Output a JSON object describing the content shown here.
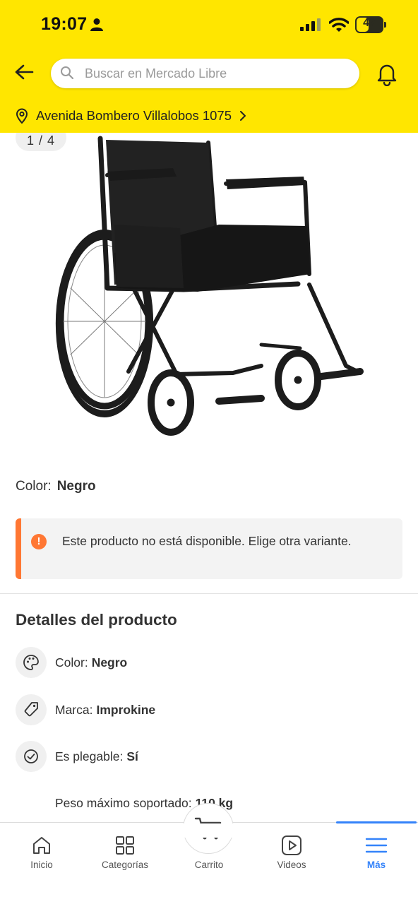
{
  "status_bar": {
    "time": "19:07",
    "battery_level": "47",
    "battery_fraction": 0.47,
    "icons": [
      "person-icon",
      "signal-icon",
      "wifi-icon",
      "battery-icon"
    ]
  },
  "header": {
    "search": {
      "placeholder": "Buscar en Mercado Libre",
      "value": ""
    },
    "address": "Avenida Bombero Villalobos 1075",
    "icons": [
      "back-arrow-icon",
      "search-icon",
      "bell-icon",
      "location-pin-icon",
      "chevron-right-icon"
    ]
  },
  "gallery": {
    "counter": "1 / 4"
  },
  "variant": {
    "label": "Color:",
    "value": "Negro"
  },
  "alert": {
    "message": "Este producto no está disponible. Elige otra variante."
  },
  "details": {
    "title": "Detalles del producto",
    "specs": [
      {
        "label": "Color:",
        "value": "Negro",
        "icon": "palette-icon"
      },
      {
        "label": "Marca:",
        "value": "Improkine",
        "icon": "tag-icon"
      },
      {
        "label": "Es plegable:",
        "value": "Sí",
        "icon": "check-circle-icon"
      },
      {
        "label": "Peso máximo soportado:",
        "value": "110 kg"
      }
    ]
  },
  "bottom_nav": {
    "items": [
      {
        "label": "Inicio",
        "icon": "home-icon"
      },
      {
        "label": "Categorías",
        "icon": "grid-icon"
      },
      {
        "label": "Carrito",
        "icon": "cart-icon"
      },
      {
        "label": "Videos",
        "icon": "play-icon"
      },
      {
        "label": "Más",
        "icon": "menu-icon",
        "active": true
      }
    ]
  },
  "colors": {
    "header_yellow": "#FFE600",
    "alert_orange": "#FF7733",
    "active_blue": "#3483FA"
  }
}
